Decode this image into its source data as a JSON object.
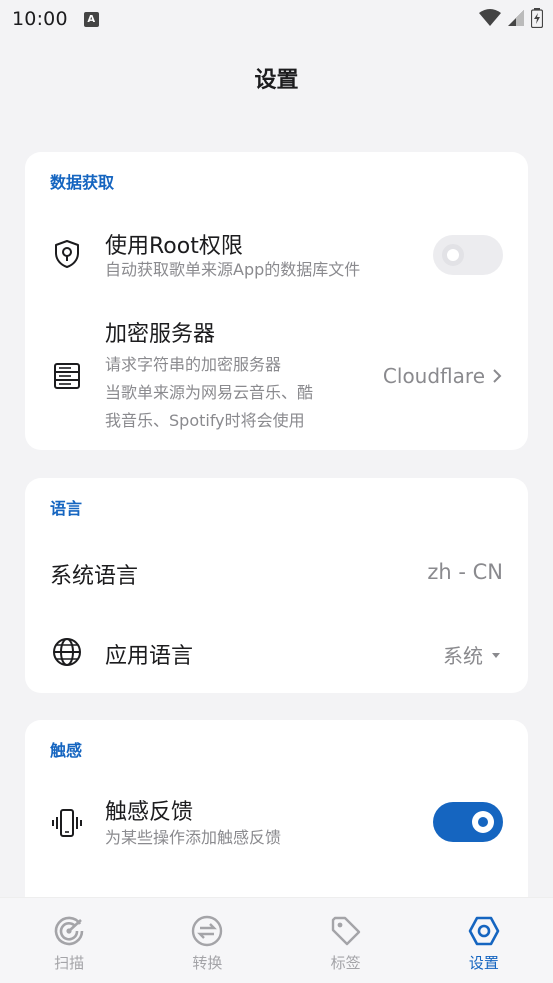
{
  "status_bar": {
    "time": "10:00",
    "notification_icon": "A"
  },
  "page": {
    "title": "设置"
  },
  "sections": {
    "data": {
      "title": "数据获取",
      "root": {
        "title": "使用Root权限",
        "subtitle": "自动获取歌单来源App的数据库文件",
        "enabled": false
      },
      "server": {
        "title": "加密服务器",
        "subtitle_lines": [
          "请求字符串的加密服务器",
          "当歌单来源为网易云音乐、酷",
          "我音乐、Spotify时将会使用"
        ],
        "value": "Cloudflare"
      }
    },
    "language": {
      "title": "语言",
      "system": {
        "title": "系统语言",
        "value": "zh - CN"
      },
      "app": {
        "title": "应用语言",
        "value": "系统"
      }
    },
    "haptic": {
      "title": "触感",
      "feedback": {
        "title": "触感反馈",
        "subtitle": "为某些操作添加触感反馈",
        "enabled": true
      }
    }
  },
  "nav": {
    "items": [
      {
        "label": "扫描",
        "icon": "scan-icon"
      },
      {
        "label": "转换",
        "icon": "convert-icon"
      },
      {
        "label": "标签",
        "icon": "tag-icon"
      },
      {
        "label": "设置",
        "icon": "settings-icon"
      }
    ],
    "active_index": 3
  },
  "colors": {
    "accent": "#1565c0",
    "background": "#f3f3f5",
    "card": "#ffffff",
    "secondary_text": "#8a8a8e"
  }
}
